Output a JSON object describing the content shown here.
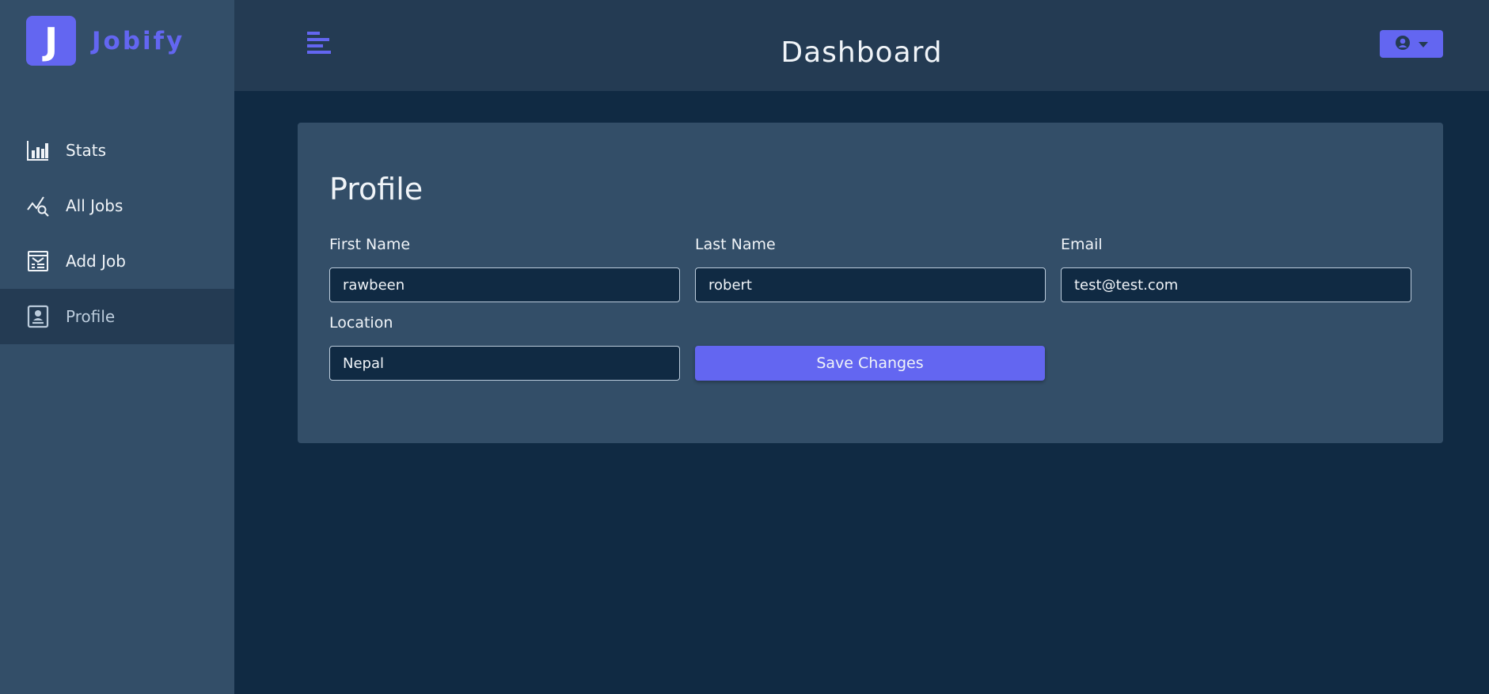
{
  "app": {
    "logo_letter": "J",
    "logo_text": "Jobify"
  },
  "sidebar": {
    "items": [
      {
        "label": "Stats",
        "icon": "bar-chart-icon"
      },
      {
        "label": "All Jobs",
        "icon": "job-search-icon"
      },
      {
        "label": "Add Job",
        "icon": "form-icon"
      },
      {
        "label": "Profile",
        "icon": "profile-icon",
        "active": true
      }
    ]
  },
  "header": {
    "title": "Dashboard"
  },
  "profile": {
    "title": "Profile",
    "first_name": {
      "label": "First Name",
      "value": "rawbeen"
    },
    "last_name": {
      "label": "Last Name",
      "value": "robert"
    },
    "email": {
      "label": "Email",
      "value": "test@test.com"
    },
    "location": {
      "label": "Location",
      "value": "Nepal"
    },
    "save_label": "Save Changes"
  },
  "colors": {
    "primary": "#6366f1",
    "background": "#102a43",
    "sidebar": "#334e68",
    "topbar": "#243b53",
    "text": "#f0f4f8"
  }
}
